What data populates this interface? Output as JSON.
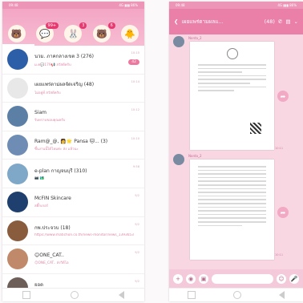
{
  "left": {
    "status_time": "09:48",
    "status_right": "4G ▮▮▮ 86%",
    "tabs": [
      {
        "icon": "brown-bear-icon",
        "badge": "",
        "glyph": "🐻"
      },
      {
        "icon": "chat-icon",
        "badge": "99+",
        "glyph": "💬"
      },
      {
        "icon": "timeline-icon",
        "badge": "3",
        "glyph": "🐰"
      },
      {
        "icon": "news-icon",
        "badge": "6",
        "glyph": "🐻"
      },
      {
        "icon": "more-icon",
        "badge": "",
        "glyph": "🐥"
      }
    ],
    "chats": [
      {
        "title": "นวม. ภาคกลางเขต 3 (276)",
        "preview": "ม.ค💬179📢 สวัสดีครับ",
        "time": "10:15",
        "unread": "42",
        "avatar_color": "#2c5fa8"
      },
      {
        "title": "เผยแพร่ตาม่ผลจัดเจริญ (48)",
        "preview": "ไม่อยู่ที่ สวัสดีครับ",
        "time": "10:14",
        "unread": "",
        "avatar_color": "#e8e8e8"
      },
      {
        "title": "Siam",
        "preview": "รับทราบขอบคุณครับ",
        "time": "10:12",
        "unread": "",
        "avatar_color": "#5c7fa6"
      },
      {
        "title": "Ram@_@, 👩🌟 Pansa 🐱... (3)",
        "preview": "ขึ้นงานนี้ได้ไหมค่ะ ส่ง แล้วนะ",
        "time": "10:10",
        "unread": "",
        "avatar_color": "#6f8db4"
      },
      {
        "title": "e-plan กาญจนบุรี (310)",
        "preview": "📷 🏞️",
        "time": "9:58",
        "unread": "",
        "avatar_color": "#7fa8c8"
      },
      {
        "title": "McFIN Skincare",
        "preview": "สติ๊กเกอร์",
        "time": "9/2",
        "unread": "",
        "avatar_color": "#1f3f6e"
      },
      {
        "title": "กพ.ประจวบ (18)",
        "preview": "https://www.matichon.co.th/news-monitor/news_1393653",
        "time": "9/2",
        "unread": "",
        "avatar_color": "#8a5c3e"
      },
      {
        "title": "😊ONE_CAT..",
        "preview": "😊ONE_CAT.. ส่งวิดีโอ",
        "time": "9/2",
        "unread": "",
        "avatar_color": "#c08a6a"
      },
      {
        "title": "ยอด",
        "preview": "ตกลงครับพี่",
        "time": "9/2",
        "unread": "",
        "avatar_color": "#6e5e58"
      }
    ]
  },
  "right": {
    "status_time": "09:48",
    "status_right": "4G ▮▮▮ 86%",
    "chat_title": "เผยแพร่ตามผลแ...",
    "member_count": "(48)",
    "sender1": "Nonta_2",
    "sender2": "Nonta_2",
    "time1": "10:11",
    "time2": "10:11",
    "read_label": "Read"
  }
}
